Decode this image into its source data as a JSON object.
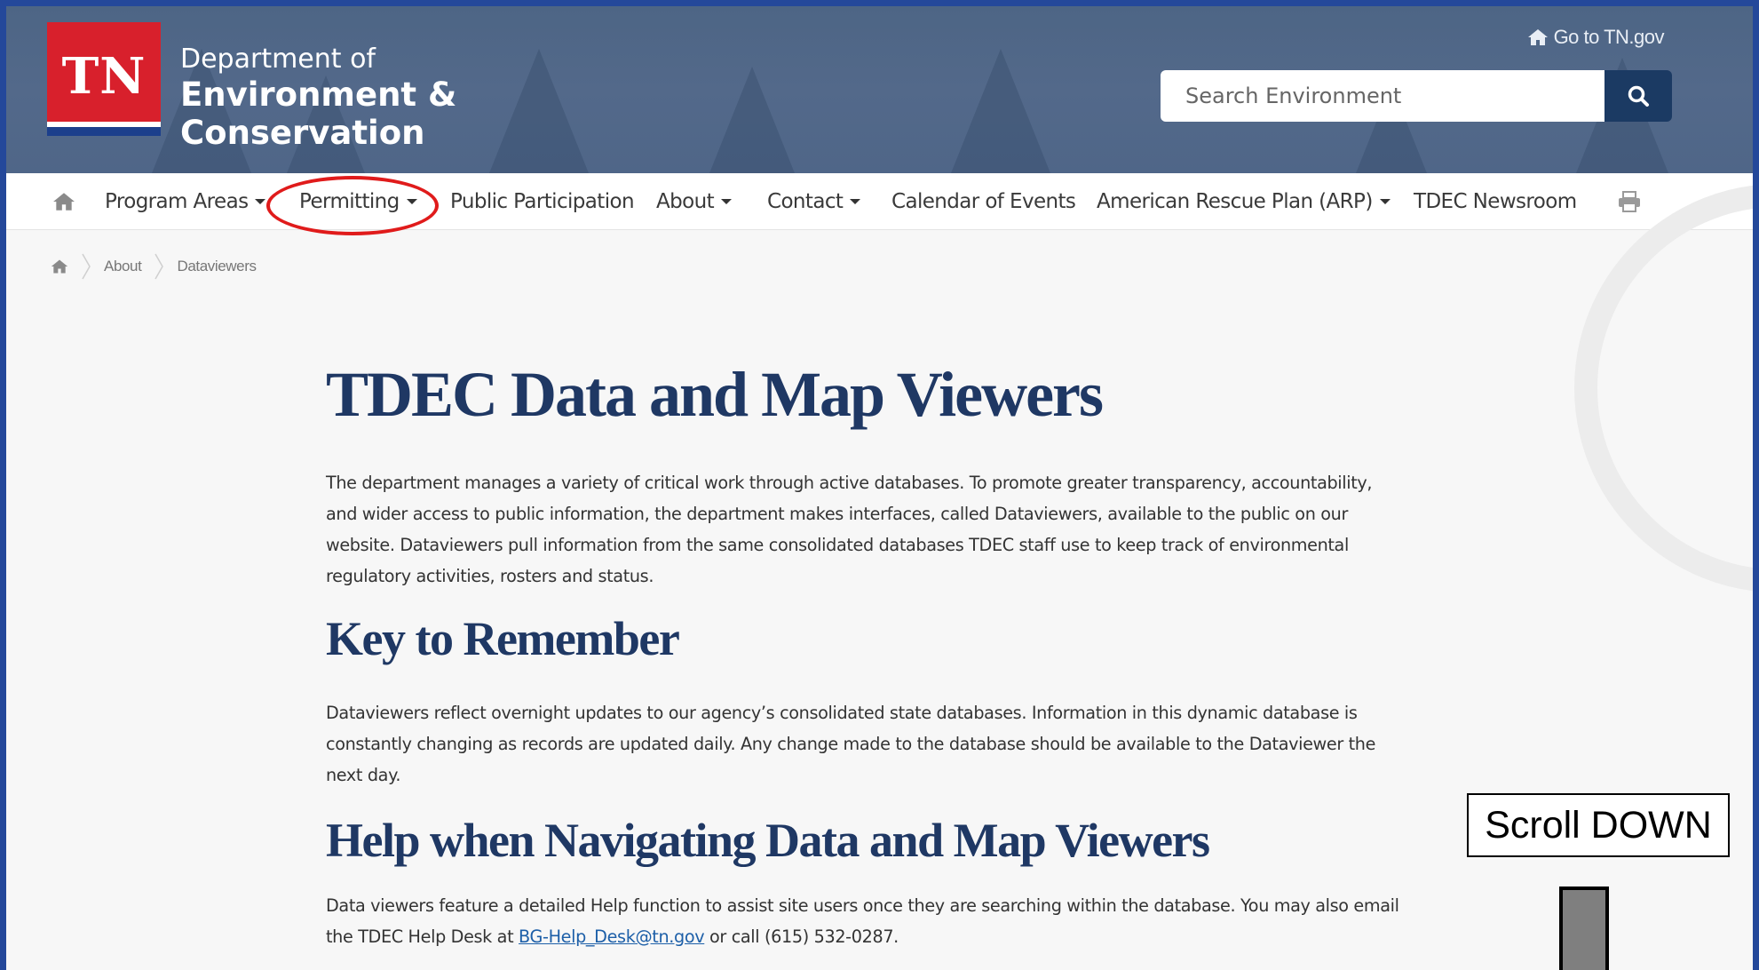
{
  "header": {
    "logo_letters": "TN",
    "logo_line1": "Department of",
    "logo_line2": "Environment &",
    "logo_line3": "Conservation",
    "goto_link": "Go to TN.gov",
    "search_placeholder": "Search Environment"
  },
  "nav": {
    "items": [
      {
        "label": "Program Areas",
        "dropdown": true
      },
      {
        "label": "Permitting",
        "dropdown": true,
        "highlighted": true
      },
      {
        "label": "Public Participation",
        "dropdown": false
      },
      {
        "label": "About",
        "dropdown": true
      },
      {
        "label": "Contact",
        "dropdown": true
      },
      {
        "label": "Calendar of Events",
        "dropdown": false
      },
      {
        "label": "American Rescue Plan (ARP)",
        "dropdown": true
      },
      {
        "label": "TDEC Newsroom",
        "dropdown": false
      }
    ]
  },
  "breadcrumb": [
    "About",
    "Dataviewers"
  ],
  "content": {
    "title": "TDEC Data and Map Viewers",
    "intro": "The department manages a variety of critical work through active databases. To promote greater transparency, accountability, and wider access to public information, the department makes interfaces, called Dataviewers, available to the public on our website. Dataviewers pull information from the same consolidated databases TDEC staff use to keep track of environmental regulatory activities, rosters and status.",
    "section1_title": "Key to Remember",
    "section1_text": "Dataviewers reflect overnight updates to our agency’s consolidated state databases. Information in this dynamic database is constantly changing as records are updated daily. Any change made to the database should be available to the Dataviewer the next day.",
    "section2_title": "Help when Navigating Data and Map Viewers",
    "section2_text_before": "Data viewers feature a detailed Help function to assist site users once they are searching within the database. You may also email the TDEC Help Desk at",
    "section2_email": "BG-Help_Desk@tn.gov",
    "section2_text_after": "or call (615) 532-0287."
  },
  "annotation": {
    "scroll_label": "Scroll DOWN"
  },
  "colors": {
    "frame": "#24489a",
    "header_bg": "#4f6688",
    "logo_red": "#d8202c",
    "heading": "#1f3864",
    "search_button": "#1b3a63",
    "highlight": "#e01b1b"
  }
}
